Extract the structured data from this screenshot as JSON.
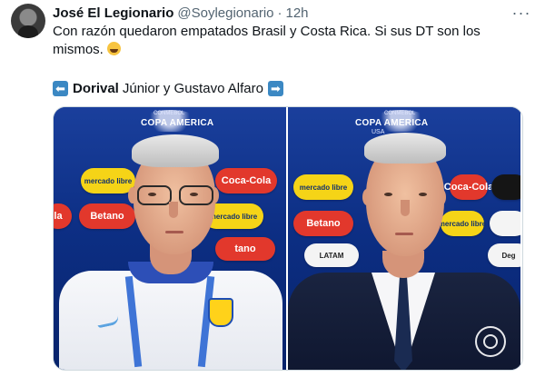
{
  "tweet": {
    "author_name": "José El Legionario",
    "handle": "@Soylegionario",
    "separator": "·",
    "time": "12h",
    "more_glyph": "···",
    "text": "Con razón quedaron empatados Brasil y Costa Rica. Si sus DT son los mismos.",
    "emoji": "rolling-on-floor-laughing",
    "caption": {
      "left_arrow": "⬅",
      "bold": "Dorival",
      "rest": "Júnior y Gustavo Alfaro",
      "right_arrow": "➡"
    }
  },
  "media": {
    "left": {
      "conmebol": "CONMEBOL",
      "event": "COPA AMERICA",
      "sponsors": {
        "mercado1": "mercado libre",
        "cocacola": "Coca-Cola",
        "betano": "Betano",
        "mercado2": "mercado libre",
        "tano": "tano",
        "cola_short": "la"
      }
    },
    "right": {
      "conmebol": "CONMEBOL",
      "event": "COPA AMERICA",
      "country": "USA",
      "sponsors": {
        "mercado1": "mercado libre",
        "cocacola": "Coca-Cola",
        "betano": "Betano",
        "mercado2": "mercado libre",
        "latam": "LATAM",
        "dev": "Deg"
      }
    }
  },
  "icons": {
    "more": "more-icon",
    "arrow_left": "left-arrow-emoji",
    "arrow_right": "right-arrow-emoji",
    "tv_logo": "globo-logo"
  },
  "colors": {
    "text": "#0f1419",
    "muted": "#536471",
    "arrow_blue": "#3b88c3",
    "studio_blue": "#0d2f85"
  }
}
